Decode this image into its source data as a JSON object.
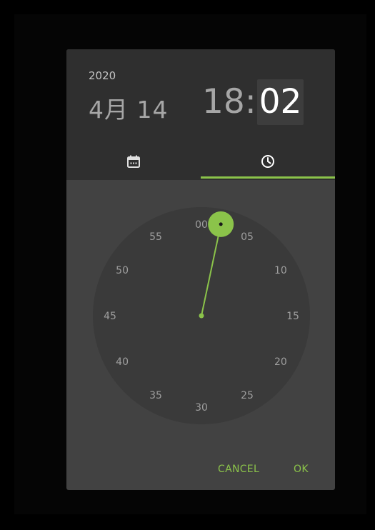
{
  "picker": {
    "year": "2020",
    "date": "4月 14",
    "time": {
      "hour": "18",
      "colon": ":",
      "minute": "02"
    },
    "tabs": [
      {
        "icon": "calendar-icon",
        "selected": false
      },
      {
        "icon": "clock-icon",
        "selected": true
      }
    ],
    "dial": {
      "mode": "minutes",
      "labels": [
        "00",
        "05",
        "10",
        "15",
        "20",
        "25",
        "30",
        "35",
        "40",
        "45",
        "50",
        "55"
      ],
      "selected_minute": 2
    },
    "actions": {
      "cancel_label": "CANCEL",
      "ok_label": "OK"
    }
  },
  "colors": {
    "accent": "#8bc34a",
    "header_bg": "#2f2f2f",
    "body_bg": "#424242",
    "dial_bg": "#3a3a3a",
    "label": "#9e9e9e"
  }
}
